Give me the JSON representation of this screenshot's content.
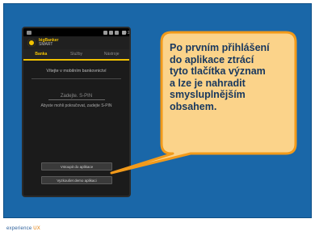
{
  "phone": {
    "status_time": "10:14",
    "logo_line1": "bigBanker",
    "logo_line2": "SMART",
    "tabs": [
      {
        "label": "Banka",
        "active": true
      },
      {
        "label": "Služby",
        "active": false
      },
      {
        "label": "Nástroje",
        "active": false
      }
    ],
    "menu_heading": "Vítejte v mobilním bankovnictví",
    "code_placeholder": "Zadejte. S-PIN",
    "code_caption": "Abyste mohli pokračovat, zadejte S-PIN",
    "button_primary": "Vstoupit do aplikace",
    "button_secondary": "Vyzkoušet demo aplikaci"
  },
  "callout": {
    "lines": [
      "Po prvním přihlášení",
      "do aplikace ztrácí",
      "tyto tlačítka význam",
      "a lze je nahradit",
      "smysluplnějším",
      "obsahem."
    ],
    "fill_color": "#fbd38a",
    "border_color": "#f29a1a",
    "text_color": "#17375e"
  },
  "footer": {
    "brand_text": "experience",
    "brand_suffix": "UX"
  },
  "colors": {
    "slide_bg": "#1a67a8",
    "phone_accent": "#f2c200"
  }
}
